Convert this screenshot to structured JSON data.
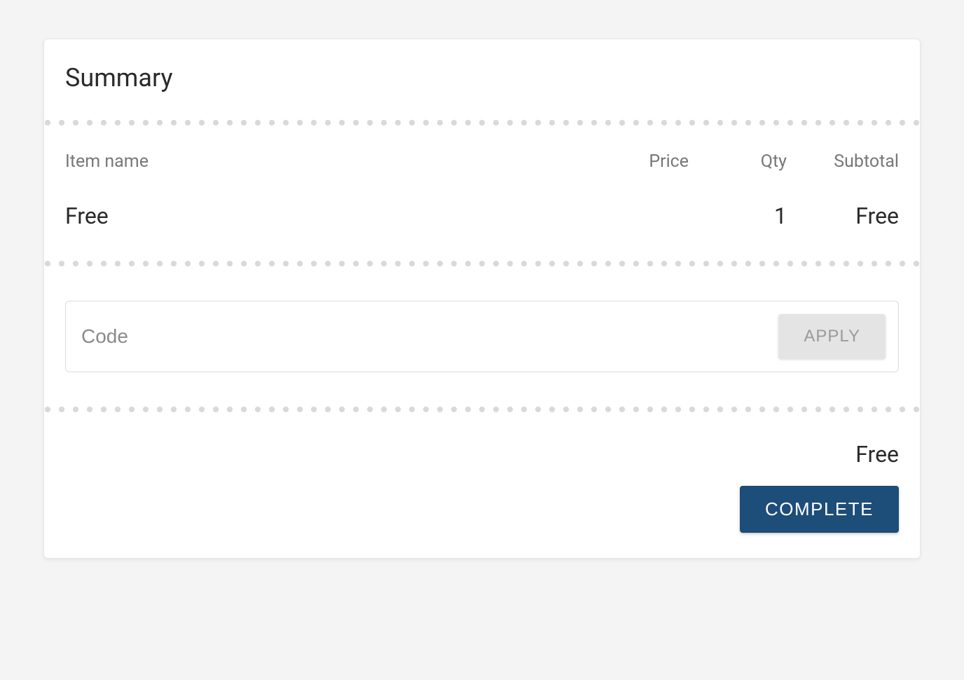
{
  "summary": {
    "title": "Summary",
    "columns": {
      "item": "Item name",
      "price": "Price",
      "qty": "Qty",
      "subtotal": "Subtotal"
    },
    "items": [
      {
        "name": "Free",
        "price": "",
        "qty": "1",
        "subtotal": "Free"
      }
    ],
    "coupon": {
      "placeholder": "Code",
      "apply_label": "APPLY"
    },
    "total": "Free",
    "complete_label": "COMPLETE"
  }
}
